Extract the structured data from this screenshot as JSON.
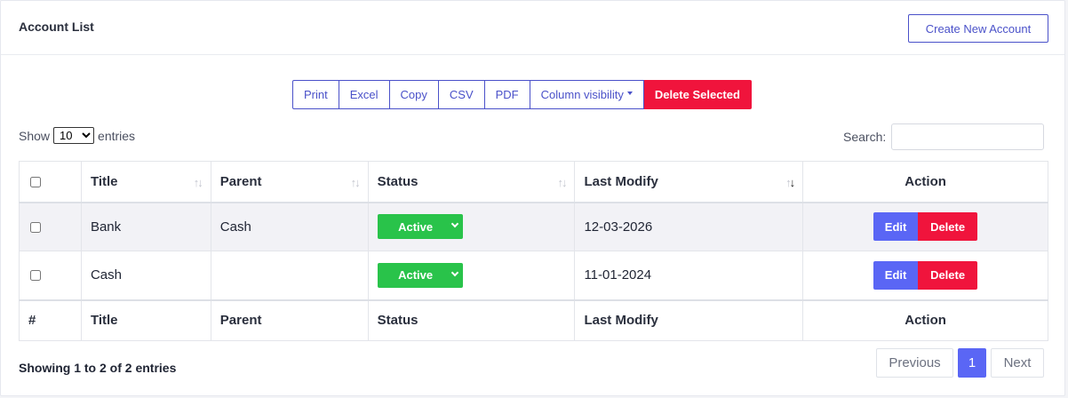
{
  "header": {
    "title": "Account List",
    "create_label": "Create New Account"
  },
  "toolbar": {
    "buttons": [
      "Print",
      "Excel",
      "Copy",
      "CSV",
      "PDF",
      "Column visibility"
    ],
    "delete_selected": "Delete Selected"
  },
  "length": {
    "show": "Show",
    "value": "10",
    "entries": "entries"
  },
  "search": {
    "label": "Search:"
  },
  "table": {
    "headers": [
      "Title",
      "Parent",
      "Status",
      "Last Modify",
      "Action"
    ],
    "footers": [
      "#",
      "Title",
      "Parent",
      "Status",
      "Last Modify",
      "Action"
    ],
    "rows": [
      {
        "title": "Bank",
        "parent": "Cash",
        "status": "Active",
        "modified": "12-03-2026"
      },
      {
        "title": "Cash",
        "parent": "",
        "status": "Active",
        "modified": "11-01-2024"
      }
    ],
    "edit_label": "Edit",
    "delete_label": "Delete"
  },
  "footer": {
    "info": "Showing 1 to 2 of 2 entries",
    "previous": "Previous",
    "current_page": "1",
    "next": "Next"
  },
  "colors": {
    "accent": "#5a66f5",
    "danger": "#f0143c",
    "success": "#29c34a",
    "outline": "#4a51c9"
  }
}
